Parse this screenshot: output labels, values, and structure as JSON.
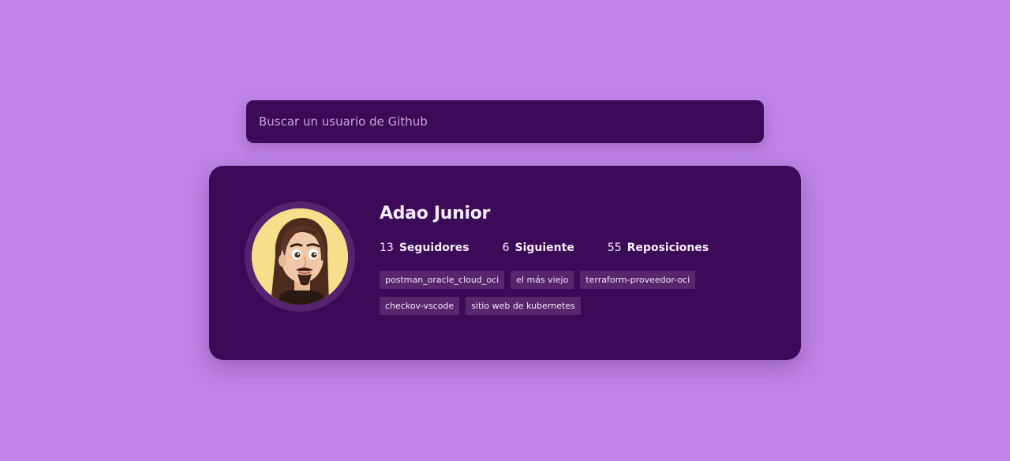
{
  "search": {
    "placeholder": "Buscar un usuario de Github",
    "value": ""
  },
  "profile": {
    "avatar_icon": "memoji-avatar",
    "name": "Adao Junior",
    "stats": [
      {
        "count": "13",
        "label": "Seguidores"
      },
      {
        "count": "6",
        "label": "Siguiente"
      },
      {
        "count": "55",
        "label": "Reposiciones"
      }
    ],
    "repos": [
      "postman_oracle_cloud_oci",
      "el más viejo",
      "terraform-proveedor-oci",
      "checkov-vscode",
      "sitio web de kubernetes"
    ]
  },
  "colors": {
    "background": "#c084e8",
    "card": "#3b0b59",
    "repo_tag": "#56276f",
    "avatar_ring": "#55226f",
    "avatar_bg": "#f5df8c"
  }
}
